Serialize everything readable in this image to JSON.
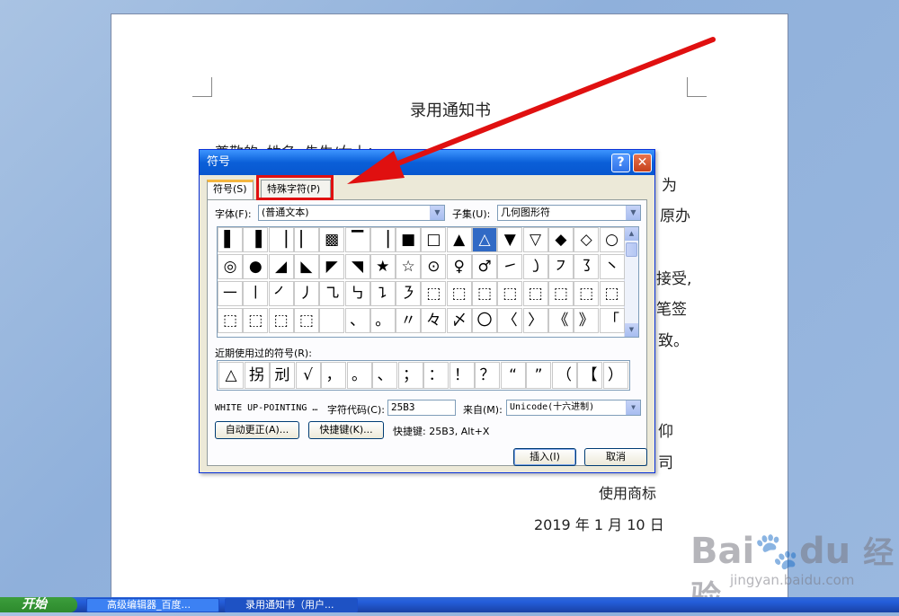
{
  "document": {
    "title": "录用通知书",
    "line_salutation": "尊敬的«姓名»先生/女士：",
    "frag_r1": "为",
    "frag_r2": "原办",
    "frag_r3": "接受,",
    "frag_r4": "笔签",
    "frag_r5": "致。",
    "frag_r6": "仰",
    "frag_r7": "司",
    "signature": "使用商标",
    "date": "2019 年 1 月 10 日"
  },
  "dialog": {
    "title": "符号",
    "help": "?",
    "close": "✕",
    "tabs": [
      "符号(S)",
      "特殊字符(P)"
    ],
    "font_label": "字体(F):",
    "font_value": "(普通文本)",
    "subset_label": "子集(U):",
    "subset_value": "几何图形符",
    "symbols": [
      [
        "▌",
        "▐",
        "▕",
        "▏",
        "▩",
        "▔",
        "▕",
        "■",
        "□",
        "▲",
        "△",
        "▼",
        "▽",
        "◆",
        "◇",
        "○"
      ],
      [
        "◎",
        "●",
        "◢",
        "◣",
        "◤",
        "◥",
        "★",
        "☆",
        "⊙",
        "♀",
        "♂",
        "㇀",
        "㇁",
        "㇇",
        "㇌",
        "㇔"
      ],
      [
        "㇐",
        "㇑",
        "㇒",
        "㇓",
        "㇈",
        "㇉",
        "㇊",
        "㇋",
        "⬚",
        "⬚",
        "⬚",
        "⬚",
        "⬚",
        "⬚",
        "⬚",
        "⬚"
      ],
      [
        "⬚",
        "⬚",
        "⬚",
        "⬚",
        "",
        "、",
        "。",
        "〃",
        "々",
        "〆",
        "〇",
        "〈",
        "〉",
        "《",
        "》",
        "「"
      ]
    ],
    "selected_symbol": "△",
    "recent_label": "近期使用过的符号(R):",
    "recent": [
      "△",
      "拐",
      "刓",
      "√",
      "，",
      "。",
      "、",
      "；",
      "：",
      "！",
      "？",
      "“",
      "”",
      "（",
      "【",
      "）"
    ],
    "char_name": "WHITE UP-POINTING …",
    "char_code_label": "字符代码(C):",
    "char_code": "25B3",
    "from_label": "来自(M):",
    "from_value": "Unicode(十六进制)",
    "autocorrect": "自动更正(A)...",
    "shortcut_btn": "快捷键(K)...",
    "shortcut_text": "快捷键: 25B3, Alt+X",
    "insert": "插入(I)",
    "cancel": "取消"
  },
  "taskbar": {
    "start": "开始",
    "tasks": [
      "高级编辑器_百度...",
      "录用通知书（用户..."
    ]
  },
  "watermark": {
    "logo": "Bai",
    "logo2": "du",
    "brand": "经验",
    "url": "jingyan.baidu.com"
  },
  "colors": {
    "highlight": "#e01010",
    "selection": "#316ac5",
    "titlebar": "#0a5fd8"
  }
}
